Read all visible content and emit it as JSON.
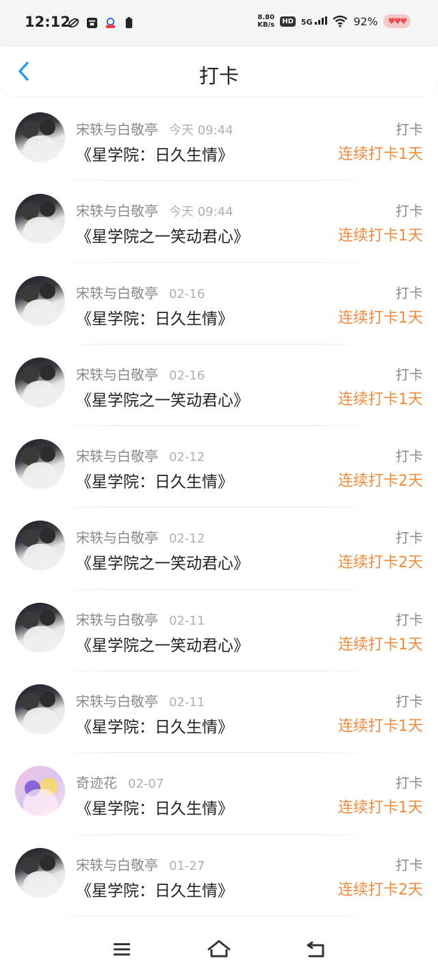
{
  "status_bar": {
    "time": "12:12",
    "net_speed_value": "8.80",
    "net_speed_unit": "KB/s",
    "hd": "HD",
    "signal": "5G",
    "battery": "92%"
  },
  "header": {
    "title": "打卡",
    "back_icon": "chevron-left-icon",
    "accent_color": "#2a9ae6"
  },
  "checkin_label": "打卡",
  "colors": {
    "streak": "#f08a3c",
    "username": "#8a8a8a",
    "time": "#b0b0b0"
  },
  "items": [
    {
      "user": "宋轶与白敬亭",
      "time": "今天 09:44",
      "title": "《星学院：日久生情》",
      "action": "打卡",
      "streak": "连续打卡1天",
      "avatar": "couple-photo"
    },
    {
      "user": "宋轶与白敬亭",
      "time": "今天 09:44",
      "title": "《星学院之一笑动君心》",
      "action": "打卡",
      "streak": "连续打卡1天",
      "avatar": "couple-photo"
    },
    {
      "user": "宋轶与白敬亭",
      "time": "02-16",
      "title": "《星学院：日久生情》",
      "action": "打卡",
      "streak": "连续打卡1天",
      "avatar": "couple-photo"
    },
    {
      "user": "宋轶与白敬亭",
      "time": "02-16",
      "title": "《星学院之一笑动君心》",
      "action": "打卡",
      "streak": "连续打卡1天",
      "avatar": "couple-photo"
    },
    {
      "user": "宋轶与白敬亭",
      "time": "02-12",
      "title": "《星学院：日久生情》",
      "action": "打卡",
      "streak": "连续打卡2天",
      "avatar": "couple-photo"
    },
    {
      "user": "宋轶与白敬亭",
      "time": "02-12",
      "title": "《星学院之一笑动君心》",
      "action": "打卡",
      "streak": "连续打卡2天",
      "avatar": "couple-photo"
    },
    {
      "user": "宋轶与白敬亭",
      "time": "02-11",
      "title": "《星学院之一笑动君心》",
      "action": "打卡",
      "streak": "连续打卡1天",
      "avatar": "couple-photo"
    },
    {
      "user": "宋轶与白敬亭",
      "time": "02-11",
      "title": "《星学院：日久生情》",
      "action": "打卡",
      "streak": "连续打卡1天",
      "avatar": "couple-photo"
    },
    {
      "user": "奇迹花",
      "time": "02-07",
      "title": "《星学院：日久生情》",
      "action": "打卡",
      "streak": "连续打卡1天",
      "avatar": "anime-girls"
    },
    {
      "user": "宋轶与白敬亭",
      "time": "01-27",
      "title": "《星学院：日久生情》",
      "action": "打卡",
      "streak": "连续打卡2天",
      "avatar": "couple-photo"
    }
  ],
  "nav": {
    "menu_icon": "menu-icon",
    "home_icon": "home-icon",
    "back_icon": "back-icon"
  }
}
